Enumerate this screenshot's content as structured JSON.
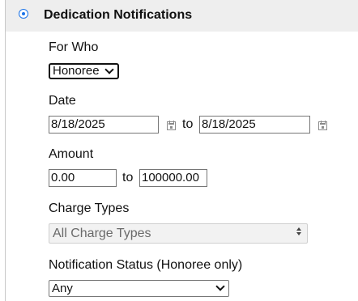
{
  "section": {
    "title": "Dedication Notifications"
  },
  "for_who": {
    "label": "For Who",
    "selected": "Honoree"
  },
  "date": {
    "label": "Date",
    "from_value": "8/18/2025",
    "to_label": "to",
    "to_value": "8/18/2025"
  },
  "amount": {
    "label": "Amount",
    "from_value": "0.00",
    "to_label": "to",
    "to_value": "100000.00"
  },
  "charge_types": {
    "label": "Charge Types",
    "selected": "All Charge Types"
  },
  "notification_status": {
    "label": "Notification Status (Honoree only)",
    "selected": "Any"
  },
  "icons": {
    "section_radio": "radio-selected-icon",
    "date_from_picker": "calendar-icon",
    "date_to_picker": "calendar-icon",
    "for_who_dropdown": "chevron-down-icon",
    "charge_types_spinner": "up-down-arrows-icon",
    "status_dropdown": "chevron-down-icon"
  },
  "colors": {
    "header_bg": "#eeeeee",
    "radio_accent": "#1a73e8",
    "disabled_field_bg": "#f2f2f2",
    "disabled_text": "#6a6a6a"
  }
}
